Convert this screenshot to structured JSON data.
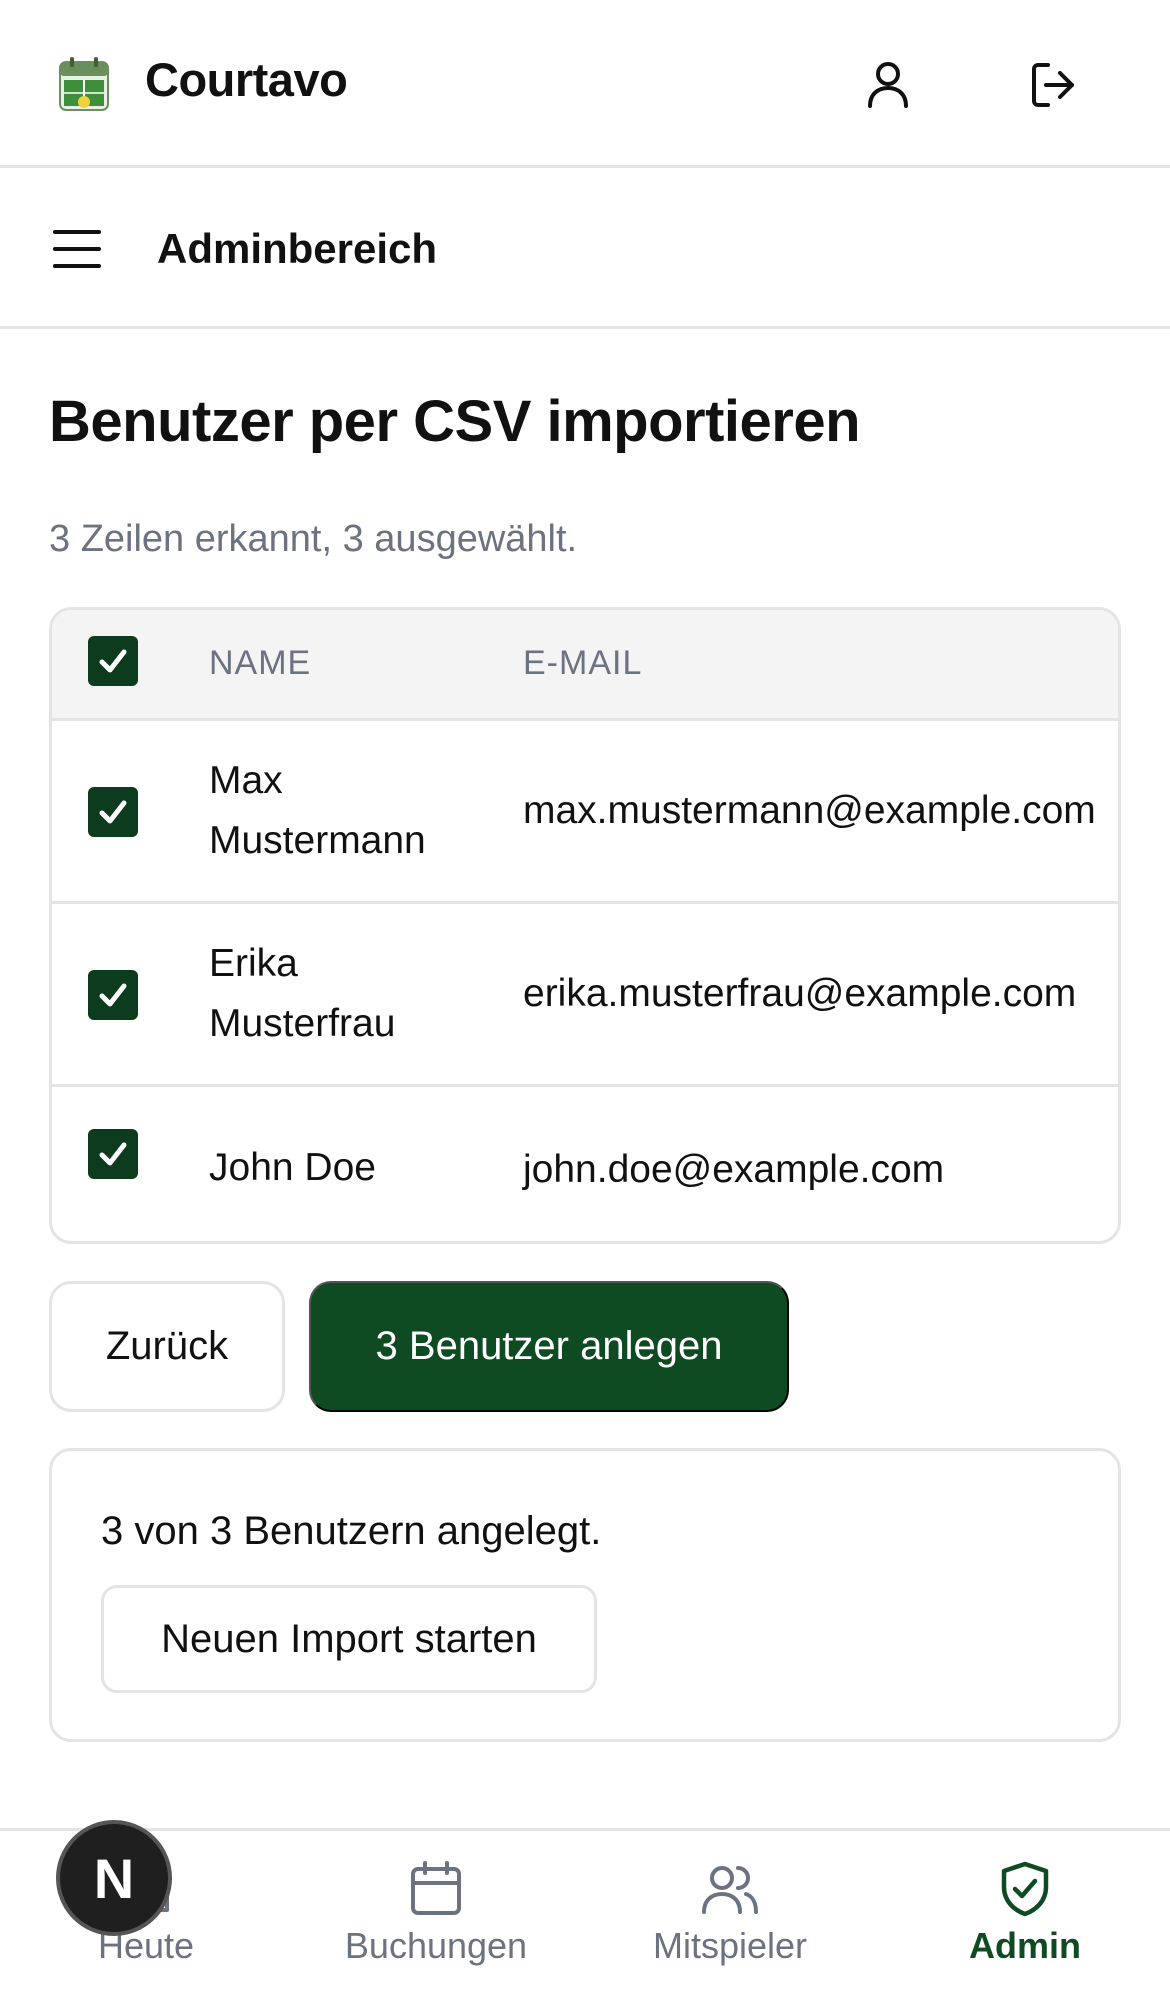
{
  "app": {
    "name": "Courtavo"
  },
  "subheader": {
    "title": "Adminbereich"
  },
  "page": {
    "title": "Benutzer per CSV importieren",
    "summary": "3 Zeilen erkannt, 3 ausgewählt."
  },
  "table": {
    "headers": {
      "name": "NAME",
      "email": "E-MAIL"
    },
    "rows": [
      {
        "name": "Max Mustermann",
        "email": "max.mustermann@example.com",
        "checked": true
      },
      {
        "name": "Erika Musterfrau",
        "email": "erika.musterfrau@example.com",
        "checked": true
      },
      {
        "name": "John Doe",
        "email": "john.doe@example.com",
        "checked": true
      }
    ]
  },
  "actions": {
    "back_label": "Zurück",
    "create_label": "3 Benutzer anlegen"
  },
  "result": {
    "text": "3 von 3 Benutzern angelegt.",
    "restart_label": "Neuen Import starten"
  },
  "nav": {
    "items": [
      {
        "label": "Heute",
        "icon": "home-icon"
      },
      {
        "label": "Buchungen",
        "icon": "calendar-icon"
      },
      {
        "label": "Mitspieler",
        "icon": "users-icon"
      },
      {
        "label": "Admin",
        "icon": "shield-check-icon"
      }
    ]
  },
  "dev_badge": {
    "letter": "N"
  },
  "colors": {
    "primary": "#0e4a22",
    "checkbox": "#0d3b1e",
    "border": "#e4e4e7",
    "muted": "#6b7280"
  }
}
